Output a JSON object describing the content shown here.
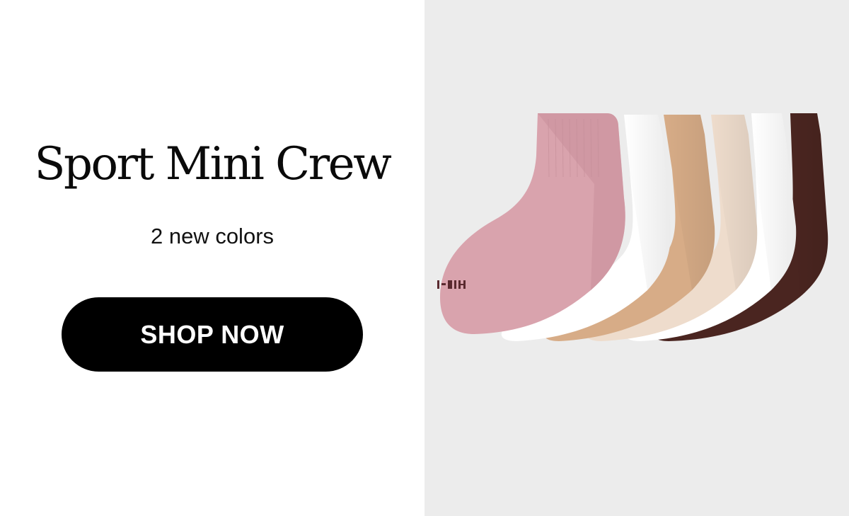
{
  "promo": {
    "title": "Sport Mini Crew",
    "subtitle": "2 new colors",
    "cta_label": "SHOP NOW"
  },
  "image": {
    "icon": "socks-product-photo",
    "sock_colors": [
      "#d9a3ad",
      "#ffffff",
      "#d7ac87",
      "#eedccc",
      "#ffffff",
      "#4a2520"
    ],
    "background": "#ececec"
  }
}
